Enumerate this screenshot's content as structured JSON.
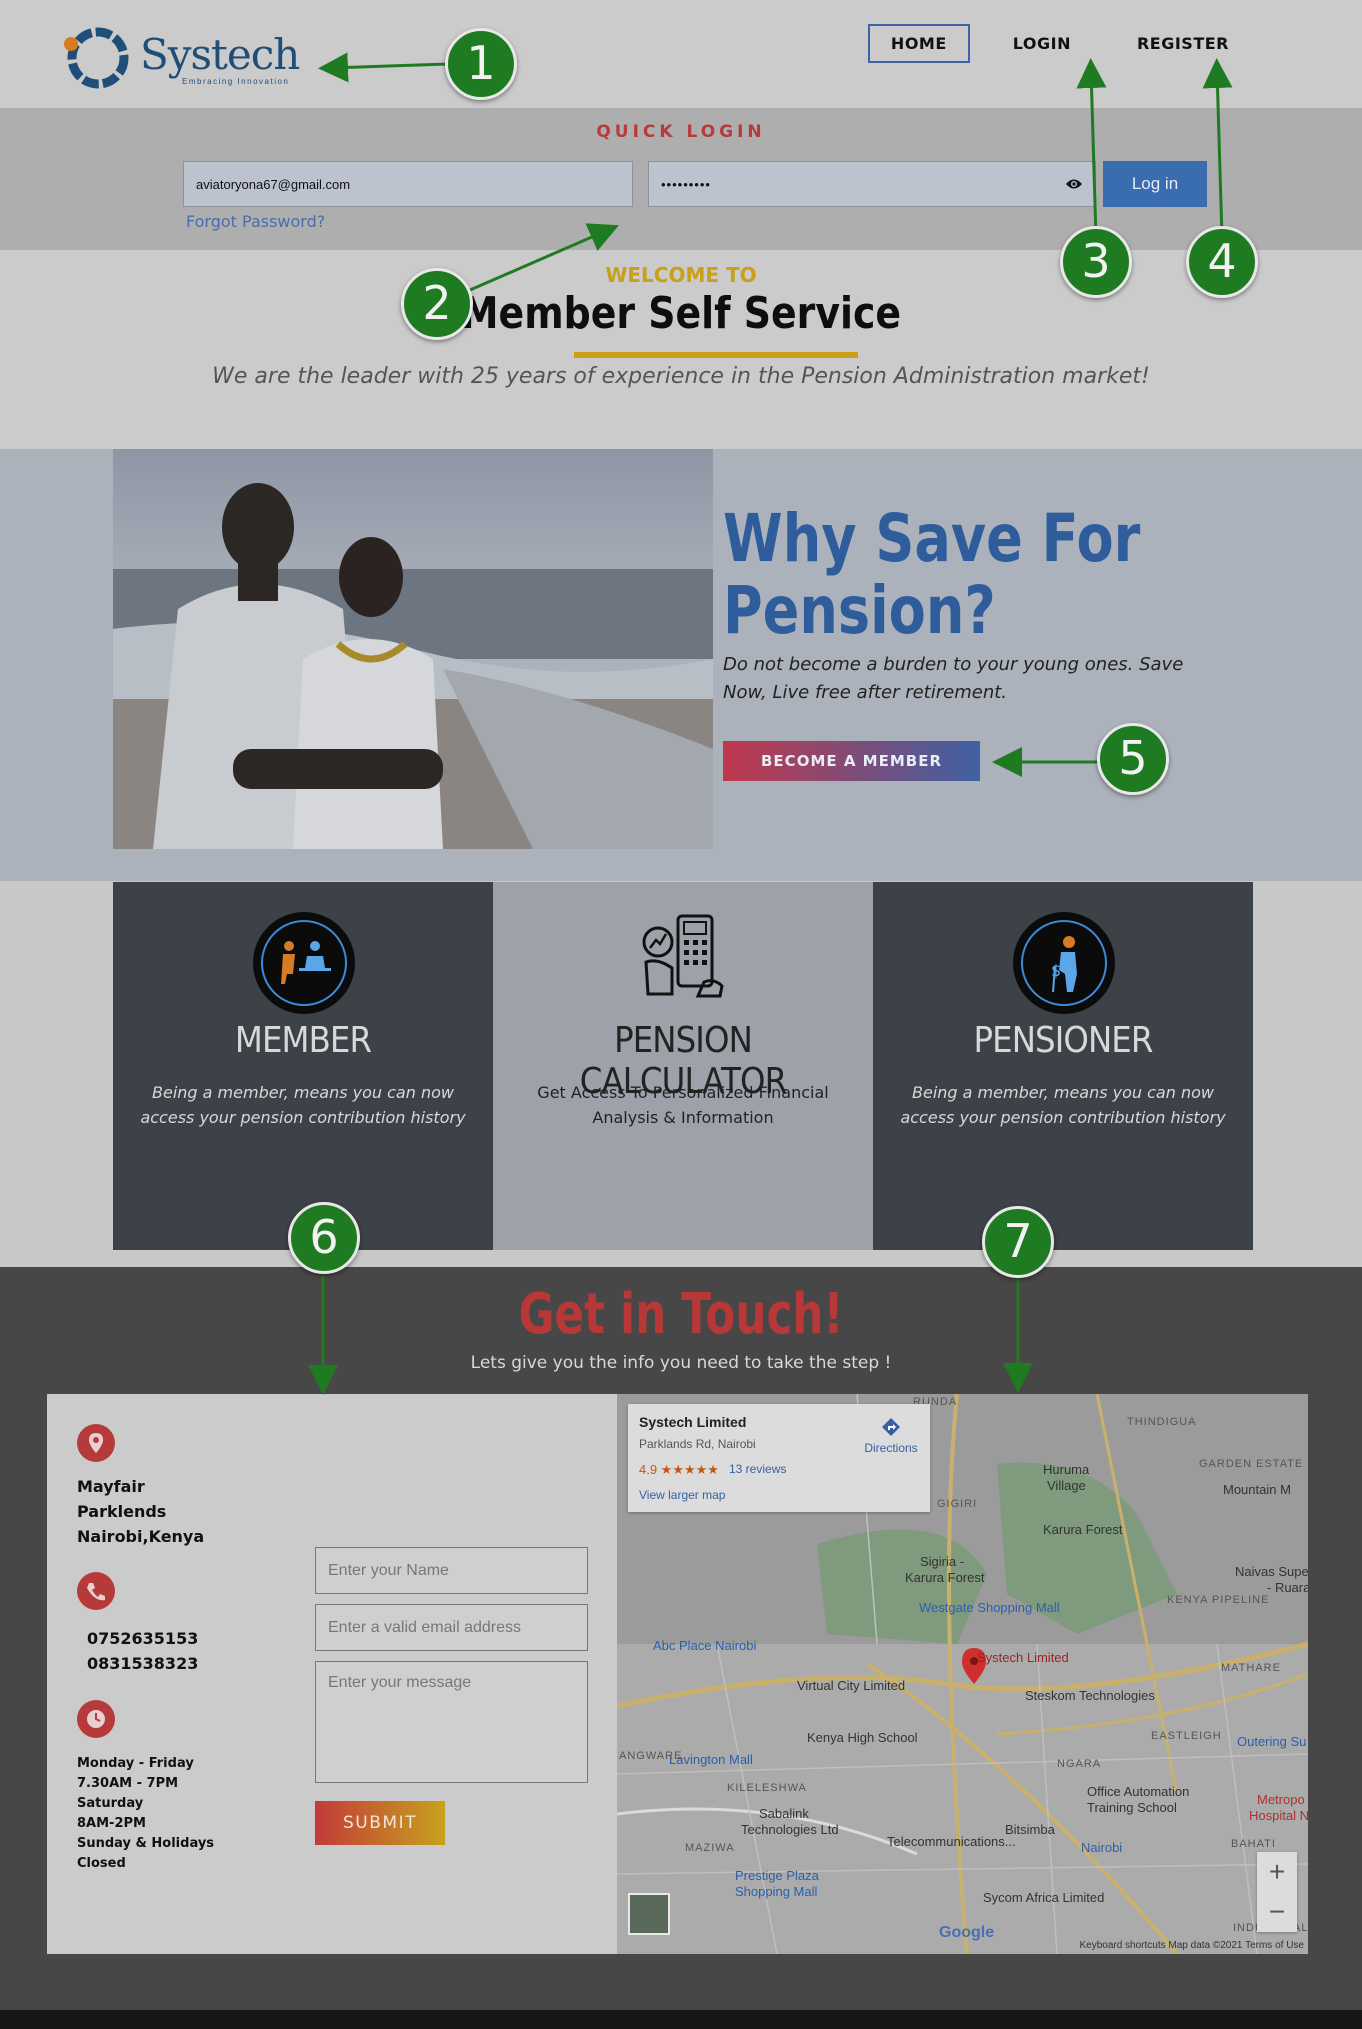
{
  "nav": {
    "logo_text": "Systech",
    "logo_tagline": "Embracing Innovation",
    "links": [
      "HOME",
      "LOGIN",
      "REGISTER"
    ]
  },
  "quick_login": {
    "title": "QUICK LOGIN",
    "email_value": "aviatoryona67@gmail.com",
    "password_value": "•••••••••",
    "login_label": "Log in",
    "forgot_label": "Forgot Password?"
  },
  "welcome": {
    "subtitle": "WELCOME TO",
    "title": "Member Self Service",
    "tagline": "We are the leader with 25 years of experience in the Pension Administration market!"
  },
  "hero": {
    "heading_line1": "Why Save For",
    "heading_line2": "Pension?",
    "text": "Do not become a burden to your young ones. Save Now, Live free after retirement.",
    "button": "BECOME A MEMBER"
  },
  "features": [
    {
      "title": "MEMBER",
      "desc": "Being a member, means you can now access your pension contribution history",
      "icon": "member-icon"
    },
    {
      "title": "PENSION CALCULATOR",
      "desc": "Get Access To Personalized Financial Analysis & Information",
      "icon": "calculator-icon"
    },
    {
      "title": "PENSIONER",
      "desc": "Being a member, means you can now access your pension contribution history",
      "icon": "pensioner-icon"
    }
  ],
  "contact": {
    "title": "Get in Touch!",
    "subtitle": "Lets give you the info you need to take the step !",
    "address": [
      "Mayfair",
      "Parklends",
      "Nairobi,Kenya"
    ],
    "phones": [
      "0752635153",
      "0831538323"
    ],
    "hours": [
      "Monday - Friday",
      "7.30AM - 7PM",
      "Saturday",
      "8AM-2PM",
      "Sunday & Holidays",
      "Closed"
    ],
    "name_placeholder": "Enter your Name",
    "email_placeholder": "Enter a valid email address",
    "message_placeholder": "Enter your message",
    "submit": "SUBMIT"
  },
  "map": {
    "place_name": "Systech Limited",
    "place_address": "Parklands Rd, Nairobi",
    "rating": "4.9 ★★★★★",
    "reviews": "13 reviews",
    "larger_map": "View larger map",
    "directions": "Directions",
    "labels": {
      "runda": "RUNDA",
      "thindigua": "THINDIGUA",
      "huruma": "Huruma",
      "village": "Village",
      "garden": "GARDEN ESTATE",
      "gigiri": "GIGIRI",
      "karura": "Karura Forest",
      "sigiria": "Sigiria -",
      "sigiria2": "Karura Forest",
      "mountain": "Mountain M",
      "westgate": "Westgate Shopping Mall",
      "naivas": "Naivas Supermark",
      "ruaraka": "- Ruara",
      "kenya_pipe": "KENYA PIPELINE",
      "abc": "Abc Place Nairobi",
      "systech": "Systech Limited",
      "mathare": "MATHARE",
      "virtual": "Virtual City Limited",
      "steskom": "Steskom Technologies",
      "kenya_high": "Kenya High School",
      "lavington": "Lavington Mall",
      "eastleigh": "EASTLEIGH",
      "outering": "Outering Su",
      "ngara": "NGARA",
      "kileleshwa": "KILELESHWA",
      "office": "Office Automation",
      "office2": "Training School",
      "sabalink": "Sabalink",
      "sabalink2": "Technologies Ltd",
      "bitsimba": "Bitsimba",
      "nairobi": "Nairobi",
      "telecom": "Telecommunications...",
      "maziwa": "MAZIWA",
      "angware": "ANGWARE",
      "metropo": "Metropo",
      "hospital": "Hospital Na",
      "bahati": "BAHATI",
      "prestige": "Prestige Plaza",
      "prestige2": "Shopping Mall",
      "sycom": "Sycom Africa Limited",
      "google": "Google",
      "industrial": "INDUSTRIAL A"
    },
    "footer": "Keyboard shortcuts   Map data ©2021   Terms of Use",
    "zoom_in": "+",
    "zoom_out": "−"
  },
  "markers": [
    "1",
    "2",
    "3",
    "4",
    "5",
    "6",
    "7"
  ],
  "colors": {
    "brand_blue": "#2f5c9b",
    "brand_red": "#b83838",
    "gold": "#c9a018",
    "marker_green": "#1f7b22"
  }
}
